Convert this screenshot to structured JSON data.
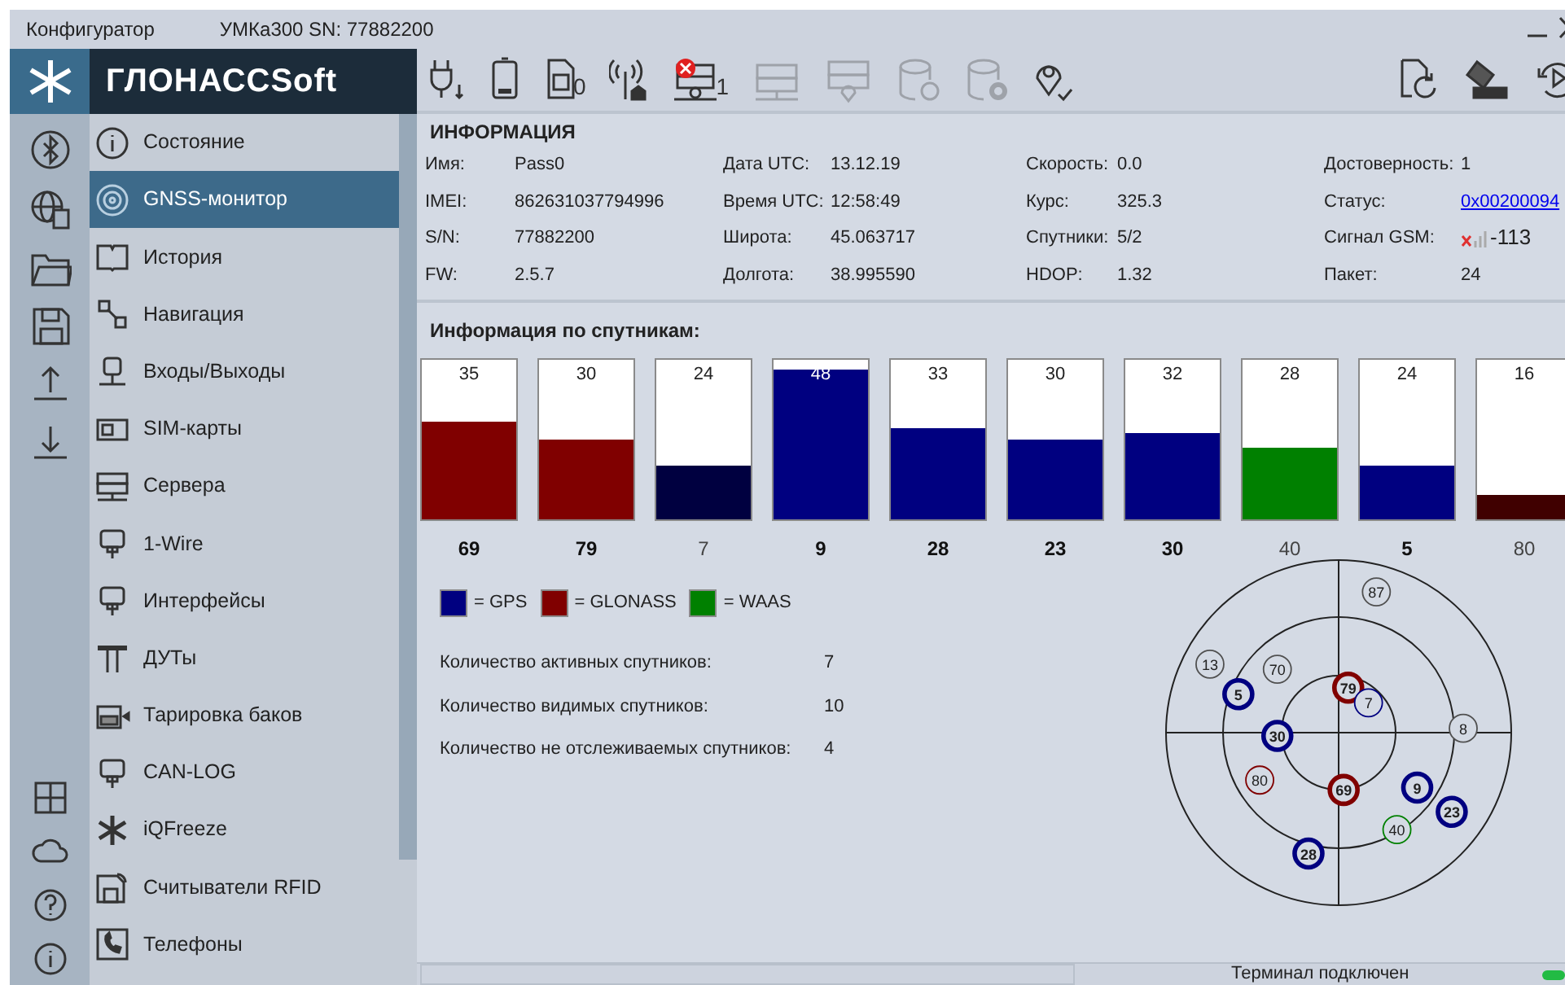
{
  "window": {
    "title": "Конфигуратор",
    "device": "УМКа300 SN: 77882200"
  },
  "brand": "ГЛОНАССSoft",
  "toolbar": {
    "left": [
      {
        "kind": "power",
        "disabled": false
      },
      {
        "kind": "battery",
        "disabled": false
      },
      {
        "kind": "sim",
        "disabled": false,
        "text": "0"
      },
      {
        "kind": "antenna",
        "disabled": false
      },
      {
        "kind": "server-error",
        "disabled": false,
        "text": "1"
      },
      {
        "kind": "server",
        "disabled": true
      },
      {
        "kind": "server-pin",
        "disabled": true
      },
      {
        "kind": "db-refresh",
        "disabled": true
      },
      {
        "kind": "db-gear",
        "disabled": true
      },
      {
        "kind": "pin-check",
        "disabled": false
      }
    ],
    "right": [
      {
        "kind": "file-refresh"
      },
      {
        "kind": "eraser"
      },
      {
        "kind": "replay"
      }
    ]
  },
  "sidebar": {
    "items": [
      {
        "label": "Состояние",
        "selected": false
      },
      {
        "label": "GNSS-монитор",
        "selected": true
      },
      {
        "label": "История",
        "selected": false
      },
      {
        "label": "Навигация",
        "selected": false
      },
      {
        "label": "Входы/Выходы",
        "selected": false
      },
      {
        "label": "SIM-карты",
        "selected": false
      },
      {
        "label": "Сервера",
        "selected": false
      },
      {
        "label": "1-Wire",
        "selected": false
      },
      {
        "label": "Интерфейсы",
        "selected": false
      },
      {
        "label": "ДУТы",
        "selected": false
      },
      {
        "label": "Тарировка баков",
        "selected": false
      },
      {
        "label": "CAN-LOG",
        "selected": false
      },
      {
        "label": "iQFreeze",
        "selected": false
      },
      {
        "label": "Считыватели RFID",
        "selected": false
      },
      {
        "label": "Телефоны",
        "selected": false
      }
    ]
  },
  "info": {
    "heading": "ИНФОРМАЦИЯ",
    "fields": [
      {
        "label": "Имя:",
        "value": "Pass0",
        "kind": "text"
      },
      {
        "label": "Дата UTC:",
        "value": "13.12.19",
        "kind": "text"
      },
      {
        "label": "Скорость:",
        "value": "0.0",
        "kind": "text"
      },
      {
        "label": "Достоверность:",
        "value": "1",
        "kind": "text"
      },
      {
        "label": "IMEI:",
        "value": "862631037794996",
        "kind": "text"
      },
      {
        "label": "Время UTC:",
        "value": "12:58:49",
        "kind": "text"
      },
      {
        "label": "Курс:",
        "value": "325.3",
        "kind": "text"
      },
      {
        "label": "Статус:",
        "value": "0x00200094",
        "kind": "link"
      },
      {
        "label": "S/N:",
        "value": "77882200",
        "kind": "text"
      },
      {
        "label": "Широта:",
        "value": "45.063717",
        "kind": "text"
      },
      {
        "label": "Спутники:",
        "value": "5/2",
        "kind": "text"
      },
      {
        "label": "Сигнал GSM:",
        "value": "-113",
        "kind": "signal"
      },
      {
        "label": "FW:",
        "value": "2.5.7",
        "kind": "text"
      },
      {
        "label": "Долгота:",
        "value": "38.995590",
        "kind": "text"
      },
      {
        "label": "HDOP:",
        "value": "1.32",
        "kind": "text"
      },
      {
        "label": "Пакет:",
        "value": "24",
        "kind": "text"
      }
    ]
  },
  "satellites": {
    "heading": "Информация по спутникам:",
    "bars": [
      {
        "signal": "35",
        "level": 0.61,
        "color": "#800000",
        "id": "69",
        "active": true
      },
      {
        "signal": "30",
        "level": 0.5,
        "color": "#800000",
        "id": "79",
        "active": true
      },
      {
        "signal": "24",
        "level": 0.34,
        "color": "#000040",
        "id": "7",
        "active": false
      },
      {
        "signal": "48",
        "level": 0.94,
        "color": "#000080",
        "id": "9",
        "active": true
      },
      {
        "signal": "33",
        "level": 0.57,
        "color": "#000080",
        "id": "28",
        "active": true
      },
      {
        "signal": "30",
        "level": 0.5,
        "color": "#000080",
        "id": "23",
        "active": true
      },
      {
        "signal": "32",
        "level": 0.54,
        "color": "#000080",
        "id": "30",
        "active": true
      },
      {
        "signal": "28",
        "level": 0.45,
        "color": "#008000",
        "id": "40",
        "active": false
      },
      {
        "signal": "24",
        "level": 0.34,
        "color": "#000080",
        "id": "5",
        "active": true
      },
      {
        "signal": "16",
        "level": 0.15,
        "color": "#400000",
        "id": "80",
        "active": false
      }
    ]
  },
  "legend": [
    {
      "label": "= GPS",
      "color": "#000080"
    },
    {
      "label": "= GLONASS",
      "color": "#800000"
    },
    {
      "label": "= WAAS",
      "color": "#008000"
    }
  ],
  "counts": [
    {
      "label": "Количество активных спутников:",
      "value": "7"
    },
    {
      "label": "Количество видимых спутников:",
      "value": "10"
    },
    {
      "label": "Количество не отслеживаемых спутников:",
      "value": "4"
    }
  ],
  "sky_plot": {
    "satellites": [
      {
        "label": "87",
        "color": "#505050",
        "active": false
      },
      {
        "label": "13",
        "color": "#505050",
        "active": false
      },
      {
        "label": "70",
        "color": "#505050",
        "active": false
      },
      {
        "label": "5",
        "color": "#000080",
        "active": true
      },
      {
        "label": "79",
        "color": "#800000",
        "active": true
      },
      {
        "label": "7",
        "color": "#000080",
        "active": false
      },
      {
        "label": "30",
        "color": "#000080",
        "active": true
      },
      {
        "label": "8",
        "color": "#505050",
        "active": false
      },
      {
        "label": "80",
        "color": "#800000",
        "active": false
      },
      {
        "label": "69",
        "color": "#800000",
        "active": true
      },
      {
        "label": "9",
        "color": "#000080",
        "active": true
      },
      {
        "label": "23",
        "color": "#000080",
        "active": true
      },
      {
        "label": "40",
        "color": "#008000",
        "active": false
      },
      {
        "label": "28",
        "color": "#000080",
        "active": true
      }
    ]
  },
  "status_bar": {
    "text": "Терминал подключен",
    "connected": true
  }
}
